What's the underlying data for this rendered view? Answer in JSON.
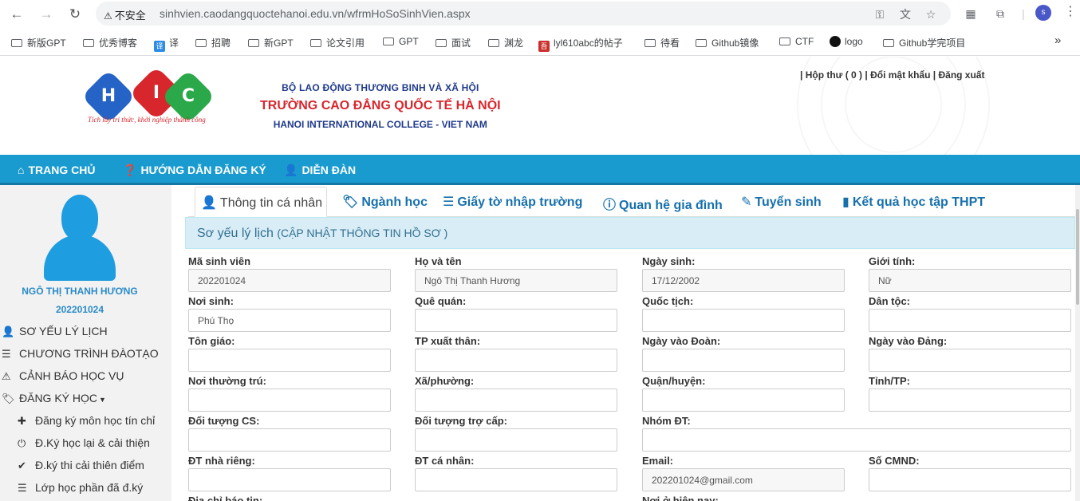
{
  "browser": {
    "security_warning": "不安全",
    "url": "sinhvien.caodangquoctehanoi.edu.vn/wfrmHoSoSinhVien.aspx",
    "profile_initial": "s",
    "bookmarks": [
      {
        "label": "新版GPT",
        "icon": "folder-icon"
      },
      {
        "label": "优秀博客",
        "icon": "folder-icon"
      },
      {
        "label": "译",
        "icon": "translate-icon"
      },
      {
        "label": "招聘",
        "icon": "folder-icon"
      },
      {
        "label": "新GPT",
        "icon": "folder-icon"
      },
      {
        "label": "论文引用",
        "icon": "folder-icon"
      },
      {
        "label": "GPT",
        "icon": "folder-icon"
      },
      {
        "label": "面试",
        "icon": "folder-icon"
      },
      {
        "label": "渊龙",
        "icon": "folder-icon"
      },
      {
        "label": "lyl610abc的帖子",
        "icon": "site-icon"
      },
      {
        "label": "待看",
        "icon": "folder-icon"
      },
      {
        "label": "Github镜像",
        "icon": "folder-icon"
      },
      {
        "label": "CTF",
        "icon": "folder-icon"
      },
      {
        "label": "logo",
        "icon": "apple-icon"
      },
      {
        "label": "Github学完项目",
        "icon": "folder-icon"
      }
    ]
  },
  "header": {
    "logo_letters": [
      "H",
      "I",
      "C"
    ],
    "slogan": "Tích lũy tri thức, khởi nghiệp thành công",
    "ministry": "BỘ LAO ĐỘNG THƯƠNG BINH VÀ XÃ HỘI",
    "school_name": "TRƯỜNG CAO ĐẲNG QUỐC TẾ HÀ NỘI",
    "school_en": "HANOI INTERNATIONAL COLLEGE - VIET NAM",
    "links": {
      "inbox": "| Hộp thư ( 0 )",
      "change_password": "| Đổi mật khẩu",
      "logout": "| Đăng xuất"
    }
  },
  "main_nav": [
    {
      "label": "TRANG CHỦ",
      "icon": "home-icon"
    },
    {
      "label": "HƯỚNG DẪN ĐĂNG KÝ",
      "icon": "question-icon"
    },
    {
      "label": "DIỄN ĐÀN",
      "icon": "user-icon"
    }
  ],
  "sidebar": {
    "student_name": "NGÔ THỊ THANH HƯƠNG",
    "student_id": "202201024",
    "items": [
      {
        "label": "SƠ YẾU LÝ LỊCH",
        "icon": "user-icon"
      },
      {
        "label": "CHƯƠNG TRÌNH ĐÀOTẠO",
        "icon": "list-icon"
      },
      {
        "label": "CẢNH BÁO HỌC VỤ",
        "icon": "warning-icon"
      },
      {
        "label": "ĐĂNG KÝ HỌC",
        "icon": "tags-icon"
      }
    ],
    "subitems": [
      {
        "label": "Đăng ký môn học tín chỉ",
        "icon": "plus-icon"
      },
      {
        "label": "Đ.Ký học lại & cải thiện",
        "icon": "power-icon"
      },
      {
        "label": "Đ.ký thi cải thiên điểm",
        "icon": "check-icon"
      },
      {
        "label": "Lớp học phần đã đ.ký",
        "icon": "list-icon"
      }
    ]
  },
  "tabs": [
    {
      "label": "Thông tin cá nhân",
      "icon": "user-icon",
      "active": true
    },
    {
      "label": "Ngành học",
      "icon": "tags-icon"
    },
    {
      "label": "Giấy tờ nhập trường",
      "icon": "list-icon"
    },
    {
      "label": "Quan hệ gia đình",
      "icon": "info-icon"
    },
    {
      "label": "Tuyển sinh",
      "icon": "edit-icon"
    },
    {
      "label": "Kết quả học tập THPT",
      "icon": "book-icon"
    }
  ],
  "panel": {
    "title": "Sơ yếu lý lịch",
    "subtitle": "(CẬP NHẬT THÔNG TIN HỒ SƠ )"
  },
  "form": {
    "rows": [
      [
        {
          "label": "Mã sinh viên",
          "value": "202201024"
        },
        {
          "label": "Họ và tên",
          "value": "Ngô Thị Thanh Hương"
        },
        {
          "label": "Ngày sinh:",
          "value": "17/12/2002"
        },
        {
          "label": "Giới tính:",
          "value": "Nữ"
        }
      ],
      [
        {
          "label": "Nơi sinh:",
          "value": "Phú Thọ"
        },
        {
          "label": "Quê quán:",
          "value": ""
        },
        {
          "label": "Quốc tịch:",
          "value": ""
        },
        {
          "label": "Dân tộc:",
          "value": ""
        }
      ],
      [
        {
          "label": "Tôn giáo:",
          "value": ""
        },
        {
          "label": "TP xuất thân:",
          "value": ""
        },
        {
          "label": "Ngày vào Đoàn:",
          "value": ""
        },
        {
          "label": "Ngày vào Đảng:",
          "value": ""
        }
      ],
      [
        {
          "label": "Nơi thường trú:",
          "value": ""
        },
        {
          "label": "Xã/phường:",
          "value": ""
        },
        {
          "label": "Quận/huyện:",
          "value": ""
        },
        {
          "label": "Tỉnh/TP:",
          "value": ""
        }
      ],
      [
        {
          "label": "Đối tượng CS:",
          "value": ""
        },
        {
          "label": "Đối tượng trợ cấp:",
          "value": ""
        },
        {
          "label": "Nhóm ĐT:",
          "value": ""
        }
      ],
      [
        {
          "label": "ĐT nhà riêng:",
          "value": ""
        },
        {
          "label": "ĐT cá nhân:",
          "value": ""
        },
        {
          "label": "Email:",
          "value": "202201024@gmail.com"
        },
        {
          "label": "Số CMND:",
          "value": ""
        }
      ],
      [
        {
          "label": "Địa chỉ báo tin:",
          "value": ""
        },
        {
          "label": "Nơi ở hiện nay:",
          "value": ""
        }
      ]
    ]
  }
}
